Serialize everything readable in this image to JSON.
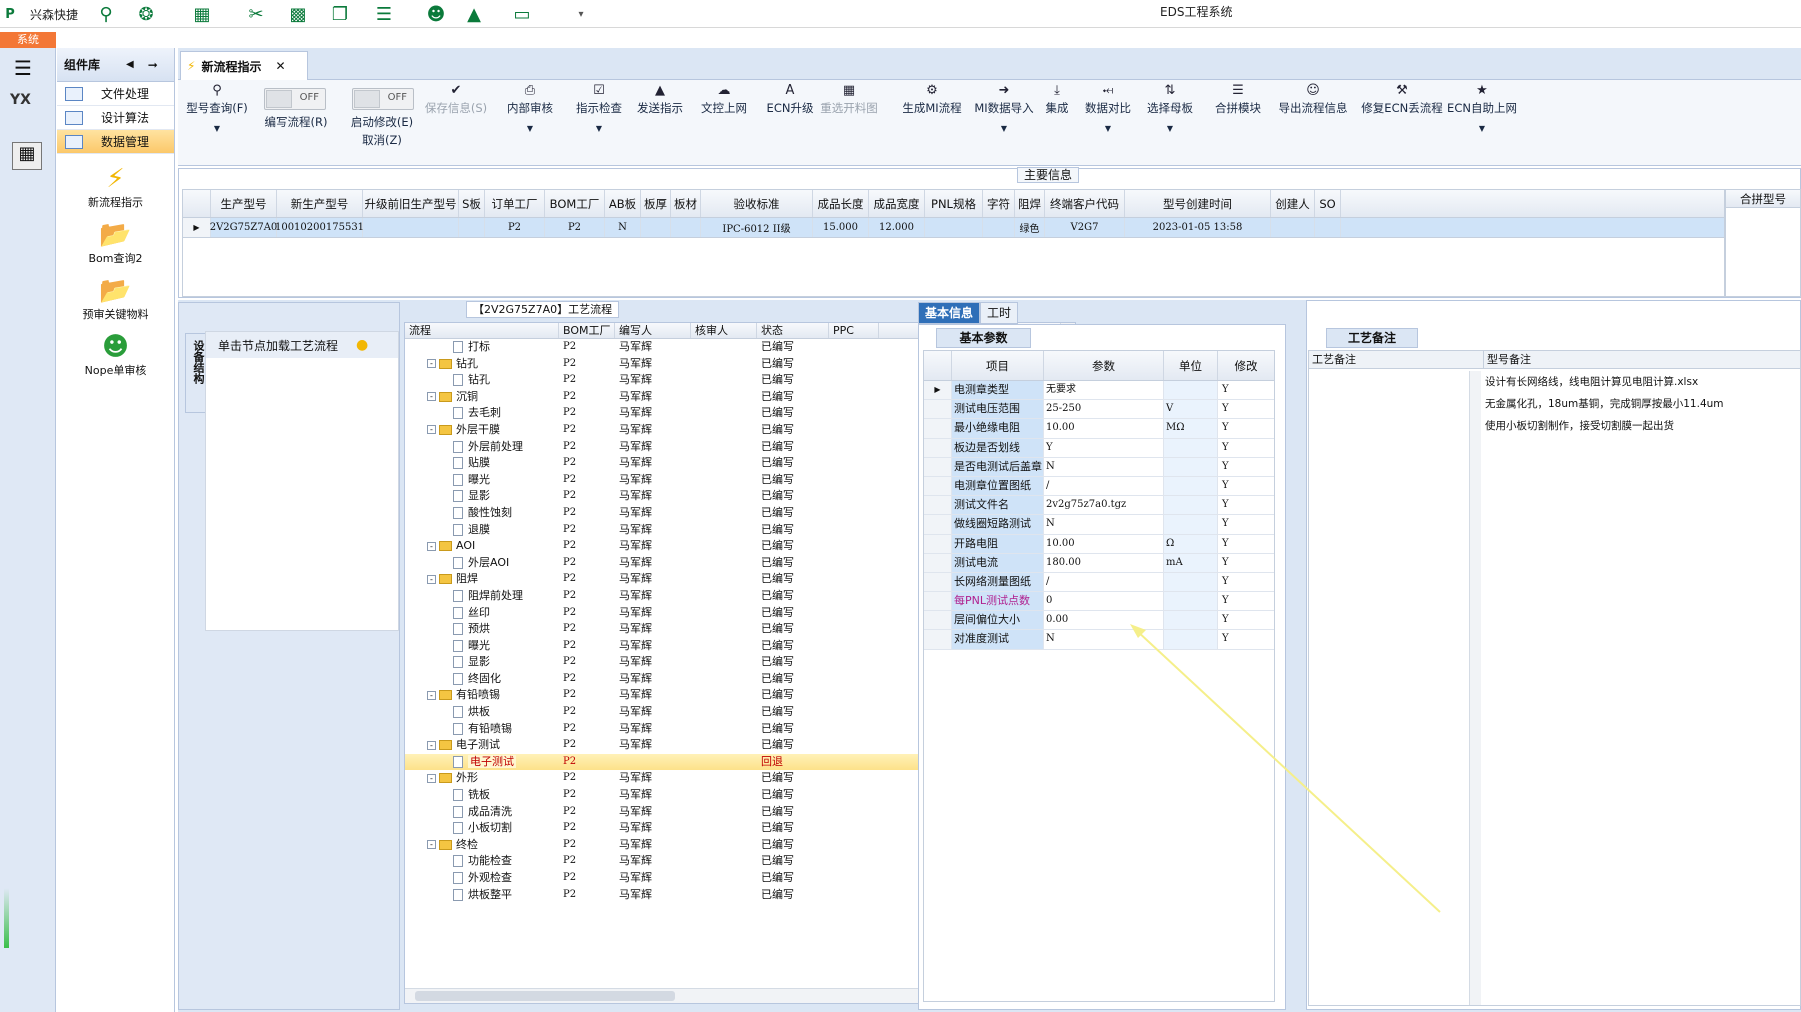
{
  "titlebar": {
    "app_name": "兴森快捷",
    "title": "EDS工程系统"
  },
  "sys_tab": "系统",
  "components": {
    "title": "组件库",
    "items": [
      {
        "label": "文件处理"
      },
      {
        "label": "设计算法"
      },
      {
        "label": "数据管理"
      }
    ],
    "big": [
      {
        "label": "新流程指示"
      },
      {
        "label": "Bom查询2"
      },
      {
        "label": "预审关键物料"
      },
      {
        "label": "Nope单审核"
      }
    ]
  },
  "doc_tab": {
    "label": "新流程指示"
  },
  "ribbon": {
    "model_query": "型号查询(F)",
    "edit_flow": "编写流程(R)",
    "start_edit": "启动修改(E)",
    "cancel": "取消(Z)",
    "off": "OFF",
    "buttons": [
      "保存信息(S)",
      "内部审核",
      "指示检查",
      "发送指示",
      "文控上网",
      "ECN升级",
      "重选开料图",
      "生成MI流程",
      "MI数据导入",
      "集成",
      "数据对比",
      "选择母板",
      "合拼模块",
      "导出流程信息",
      "修复ECN丢流程",
      "ECN自助上网"
    ]
  },
  "main_info": {
    "title": "主要信息",
    "columns": [
      "生产型号",
      "新生产型号",
      "升级前旧生产型号",
      "S板",
      "订单工厂",
      "BOM工厂",
      "AB板",
      "板厚",
      "板材",
      "验收标准",
      "成品长度",
      "成品宽度",
      "PNL规格",
      "字符",
      "阻焊",
      "终端客户代码",
      "型号创建时间",
      "创建人",
      "SO"
    ],
    "row": [
      "2V2G75Z7A0",
      "10010200175531",
      "",
      "",
      "P2",
      "P2",
      "N",
      "",
      "",
      "IPC-6012 II级",
      "15.000",
      "12.000",
      "",
      "",
      "绿色",
      "V2G7",
      "2023-01-05 13:58",
      "",
      ""
    ],
    "right_header": "合拼型号"
  },
  "left_panel": {
    "vtab": "设备结构",
    "load_hint": "单击节点加载工艺流程"
  },
  "flow": {
    "title": "【2V2G75Z7A0】工艺流程",
    "columns": [
      "流程",
      "BOM工厂",
      "编写人",
      "核审人",
      "状态",
      "PPC"
    ],
    "rows": [
      {
        "name": "打标",
        "level": 2,
        "bom": "P2",
        "writer": "马军辉",
        "status": "已编写"
      },
      {
        "name": "钻孔",
        "level": 1,
        "bom": "P2",
        "writer": "马军辉",
        "status": "已编写"
      },
      {
        "name": "钻孔",
        "level": 2,
        "bom": "P2",
        "writer": "马军辉",
        "status": "已编写"
      },
      {
        "name": "沉铜",
        "level": 1,
        "bom": "P2",
        "writer": "马军辉",
        "status": "已编写"
      },
      {
        "name": "去毛刺",
        "level": 2,
        "bom": "P2",
        "writer": "马军辉",
        "status": "已编写"
      },
      {
        "name": "外层干膜",
        "level": 1,
        "bom": "P2",
        "writer": "马军辉",
        "status": "已编写"
      },
      {
        "name": "外层前处理",
        "level": 2,
        "bom": "P2",
        "writer": "马军辉",
        "status": "已编写"
      },
      {
        "name": "贴膜",
        "level": 2,
        "bom": "P2",
        "writer": "马军辉",
        "status": "已编写"
      },
      {
        "name": "曝光",
        "level": 2,
        "bom": "P2",
        "writer": "马军辉",
        "status": "已编写"
      },
      {
        "name": "显影",
        "level": 2,
        "bom": "P2",
        "writer": "马军辉",
        "status": "已编写"
      },
      {
        "name": "酸性蚀刻",
        "level": 2,
        "bom": "P2",
        "writer": "马军辉",
        "status": "已编写"
      },
      {
        "name": "退膜",
        "level": 2,
        "bom": "P2",
        "writer": "马军辉",
        "status": "已编写"
      },
      {
        "name": "AOI",
        "level": 1,
        "bom": "P2",
        "writer": "马军辉",
        "status": "已编写"
      },
      {
        "name": "外层AOI",
        "level": 2,
        "bom": "P2",
        "writer": "马军辉",
        "status": "已编写"
      },
      {
        "name": "阻焊",
        "level": 1,
        "bom": "P2",
        "writer": "马军辉",
        "status": "已编写"
      },
      {
        "name": "阻焊前处理",
        "level": 2,
        "bom": "P2",
        "writer": "马军辉",
        "status": "已编写"
      },
      {
        "name": "丝印",
        "level": 2,
        "bom": "P2",
        "writer": "马军辉",
        "status": "已编写"
      },
      {
        "name": "预烘",
        "level": 2,
        "bom": "P2",
        "writer": "马军辉",
        "status": "已编写"
      },
      {
        "name": "曝光",
        "level": 2,
        "bom": "P2",
        "writer": "马军辉",
        "status": "已编写"
      },
      {
        "name": "显影",
        "level": 2,
        "bom": "P2",
        "writer": "马军辉",
        "status": "已编写"
      },
      {
        "name": "终固化",
        "level": 2,
        "bom": "P2",
        "writer": "马军辉",
        "status": "已编写"
      },
      {
        "name": "有铅喷锡",
        "level": 1,
        "bom": "P2",
        "writer": "马军辉",
        "status": "已编写"
      },
      {
        "name": "烘板",
        "level": 2,
        "bom": "P2",
        "writer": "马军辉",
        "status": "已编写"
      },
      {
        "name": "有铅喷锡",
        "level": 2,
        "bom": "P2",
        "writer": "马军辉",
        "status": "已编写"
      },
      {
        "name": "电子测试",
        "level": 1,
        "bom": "P2",
        "writer": "马军辉",
        "status": "已编写"
      },
      {
        "name": "电子测试",
        "level": 2,
        "bom": "P2",
        "writer": "",
        "status": "回退",
        "selected": true
      },
      {
        "name": "外形",
        "level": 1,
        "bom": "P2",
        "writer": "马军辉",
        "status": "已编写"
      },
      {
        "name": "铣板",
        "level": 2,
        "bom": "P2",
        "writer": "马军辉",
        "status": "已编写"
      },
      {
        "name": "成品清洗",
        "level": 2,
        "bom": "P2",
        "writer": "马军辉",
        "status": "已编写"
      },
      {
        "name": "小板切割",
        "level": 2,
        "bom": "P2",
        "writer": "马军辉",
        "status": "已编写"
      },
      {
        "name": "终检",
        "level": 1,
        "bom": "P2",
        "writer": "马军辉",
        "status": "已编写"
      },
      {
        "name": "功能检查",
        "level": 2,
        "bom": "P2",
        "writer": "马军辉",
        "status": "已编写"
      },
      {
        "name": "外观检查",
        "level": 2,
        "bom": "P2",
        "writer": "马军辉",
        "status": "已编写"
      },
      {
        "name": "烘板整平",
        "level": 2,
        "bom": "P2",
        "writer": "马军辉",
        "status": "已编写"
      }
    ]
  },
  "basic": {
    "tabs": [
      "基本信息",
      "工时"
    ],
    "section": "基本参数",
    "columns": [
      "项目",
      "参数",
      "单位",
      "修改"
    ],
    "rows": [
      {
        "item": "电测章类型",
        "value": "无要求",
        "unit": "",
        "mod": "Y"
      },
      {
        "item": "测试电压范围",
        "value": "25-250",
        "unit": "V",
        "mod": "Y"
      },
      {
        "item": "最小绝缘电阻",
        "value": "10.00",
        "unit": "MΩ",
        "mod": "Y"
      },
      {
        "item": "板边是否划线",
        "value": "Y",
        "unit": "",
        "mod": "Y"
      },
      {
        "item": "是否电测试后盖章",
        "value": "N",
        "unit": "",
        "mod": "Y"
      },
      {
        "item": "电测章位置图纸",
        "value": "/",
        "unit": "",
        "mod": "Y"
      },
      {
        "item": "测试文件名",
        "value": "2v2g75z7a0.tgz",
        "unit": "",
        "mod": "Y"
      },
      {
        "item": "做线圈短路测试",
        "value": "N",
        "unit": "",
        "mod": "Y"
      },
      {
        "item": "开路电阻",
        "value": "10.00",
        "unit": "Ω",
        "mod": "Y"
      },
      {
        "item": "测试电流",
        "value": "180.00",
        "unit": "mA",
        "mod": "Y"
      },
      {
        "item": "长网络测量图纸",
        "value": "/",
        "unit": "",
        "mod": "Y"
      },
      {
        "item": "每PNL测试点数",
        "value": "0",
        "unit": "",
        "mod": "Y",
        "accent": true
      },
      {
        "item": "层间偏位大小",
        "value": "0.00",
        "unit": "",
        "mod": "Y"
      },
      {
        "item": "对准度测试",
        "value": "N",
        "unit": "",
        "mod": "Y"
      }
    ]
  },
  "notes": {
    "title": "工艺备注",
    "col1": "工艺备注",
    "col2": "型号备注",
    "lines": [
      "设计有长网络线，线电阻计算见电阻计算.xlsx",
      "无金属化孔，18um基铜，完成铜厚按最小11.4um",
      "使用小板切割制作，接受切割膜一起出货"
    ]
  },
  "colors": {
    "accent": "#2f6fb8",
    "highlight": "#fde28a",
    "selected_row": "#cfe3f8",
    "rollback": "#c00000"
  }
}
